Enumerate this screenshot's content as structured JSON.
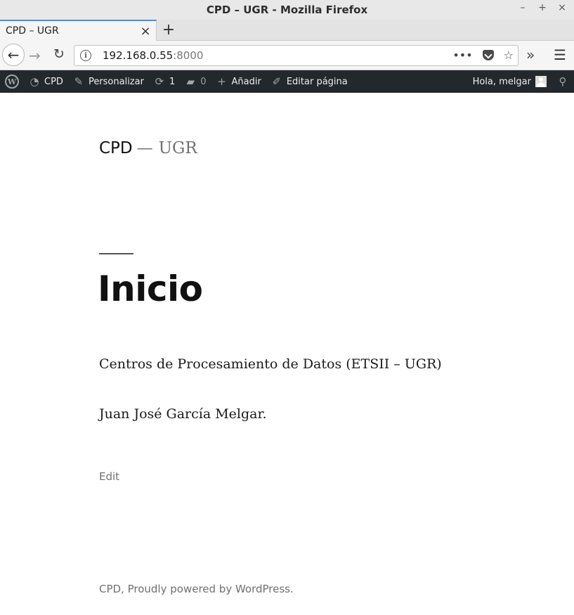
{
  "window": {
    "title": "CPD – UGR - Mozilla Firefox",
    "controls": {
      "minimize": "–",
      "maximize": "+",
      "close": "×"
    }
  },
  "tabs": [
    {
      "label": "CPD – UGR",
      "close": "×",
      "active": true
    }
  ],
  "new_tab": "+",
  "navigation": {
    "back": "←",
    "forward": "→",
    "reload": "↻",
    "url_host": "192.168.0.55",
    "url_port": ":8000",
    "page_actions": "•••",
    "bookmark": "☆",
    "overflow": "»",
    "menu": "☰"
  },
  "admin_bar": {
    "wp_logo": "W",
    "site_name": "CPD",
    "customize": "Personalizar",
    "updates_count": "1",
    "comments_count": "0",
    "new_content": "Añadir",
    "edit_page": "Editar página",
    "greeting": "Hola, melgar"
  },
  "site": {
    "title": "CPD",
    "separator": "—",
    "description": "UGR"
  },
  "page": {
    "heading": "Inicio",
    "paragraphs": [
      "Centros de Procesamiento de Datos (ETSII – UGR)",
      "Juan José García Melgar."
    ],
    "edit_link": "Edit"
  },
  "footer": {
    "text": "CPD, Proudly powered by WordPress."
  },
  "colors": {
    "admin_bar_bg": "#23282d",
    "admin_bar_icon": "#a0a5aa",
    "muted_text": "#707070",
    "active_tab_accent": "#4a90d9"
  }
}
